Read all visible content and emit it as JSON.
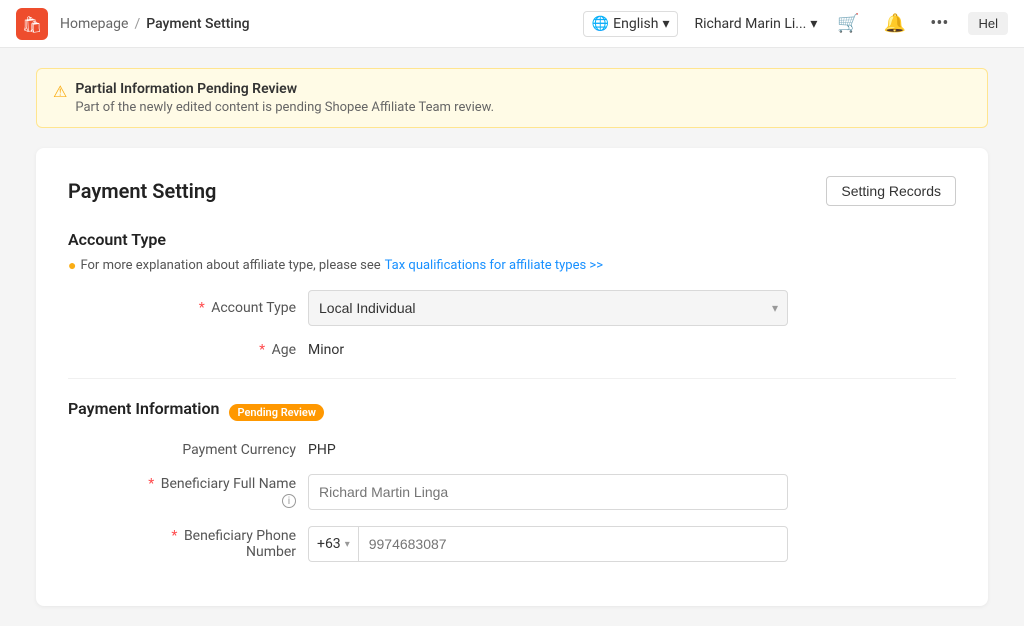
{
  "header": {
    "logo_alt": "Shopee Affiliate Logo",
    "breadcrumb_home": "Homepage",
    "breadcrumb_separator": "/",
    "breadcrumb_current": "Payment Setting",
    "language": "English",
    "user_name": "Richard Marin Li...",
    "help_label": "Hel"
  },
  "alert": {
    "title": "Partial Information Pending Review",
    "subtitle": "Part of the newly edited content is pending Shopee Affiliate Team review."
  },
  "card": {
    "title": "Payment Setting",
    "setting_records_btn": "Setting Records"
  },
  "account_type_section": {
    "title": "Account Type",
    "hint_text": "For more explanation about affiliate type, please see",
    "hint_link": "Tax qualifications for affiliate types >>",
    "account_type_label": "Account Type",
    "account_type_value": "Local Individual",
    "age_label": "Age",
    "age_value": "Minor"
  },
  "payment_info_section": {
    "title": "Payment Information",
    "badge": "Pending Review",
    "currency_label": "Payment Currency",
    "currency_value": "PHP",
    "beneficiary_name_label": "Beneficiary Full Name",
    "beneficiary_name_placeholder": "Richard Martin Linga",
    "beneficiary_phone_label": "Beneficiary Phone Number",
    "phone_country_code": "+63",
    "phone_number": "9974683087"
  }
}
